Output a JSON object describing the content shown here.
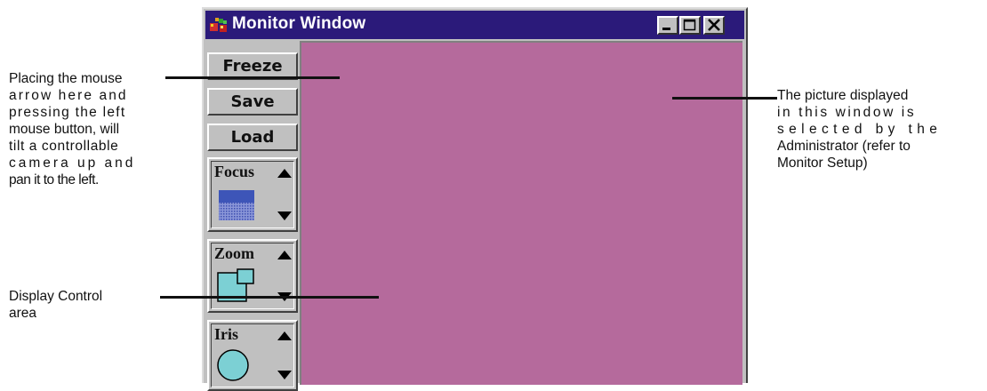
{
  "window": {
    "title": "Monitor Window",
    "buttons": {
      "freeze": "Freeze",
      "save": "Save",
      "load": "Load"
    },
    "controls": {
      "focus": "Focus",
      "zoom": "Zoom",
      "iris": "Iris"
    },
    "colors": {
      "titlebar": "#2b1a7a",
      "display": "#b56a9c",
      "face": "#c0c0c0",
      "icon_fill": "#7cd0d4"
    }
  },
  "annotations": {
    "camera_line1": "Placing the mouse",
    "camera_line2": "arrow here and",
    "camera_line3": "pressing the left",
    "camera_line4": "mouse button, will",
    "camera_line5": "tilt a controllable",
    "camera_line6": "camera up and",
    "camera_line7": "pan it to the left.",
    "display_line1": "Display Control",
    "display_line2": "area",
    "picture_line1": "The picture displayed",
    "picture_line2": "in this window is",
    "picture_line3": "selected by the",
    "picture_line4": "Administrator (refer to",
    "picture_line5": "Monitor Setup)"
  }
}
